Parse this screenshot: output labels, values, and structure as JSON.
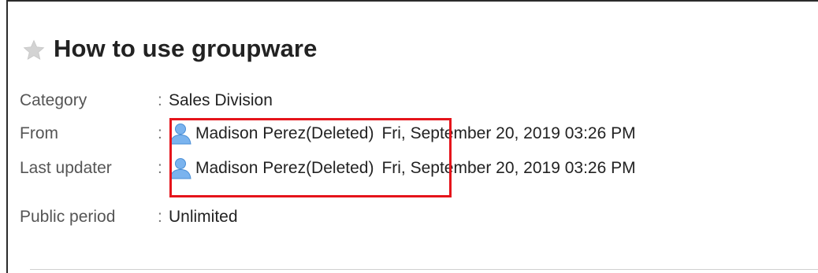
{
  "page": {
    "title": "How to use groupware"
  },
  "fields": {
    "category": {
      "label": "Category",
      "sep": ":",
      "value": "Sales Division"
    },
    "from": {
      "label": "From",
      "sep": ":",
      "user": "Madison Perez(Deleted)",
      "date": "Fri, September 20, 2019 03:26 PM"
    },
    "last_updater": {
      "label": "Last updater",
      "sep": ":",
      "user": "Madison Perez(Deleted)",
      "date": "Fri, September 20, 2019 03:26 PM"
    },
    "public_period": {
      "label": "Public period",
      "sep": ":",
      "value": "Unlimited"
    }
  },
  "icons": {
    "star": "star-icon",
    "user": "user-icon"
  },
  "colors": {
    "highlight": "#e5141b",
    "user_icon": "#6aa6e8",
    "star": "#cfcfcf"
  }
}
